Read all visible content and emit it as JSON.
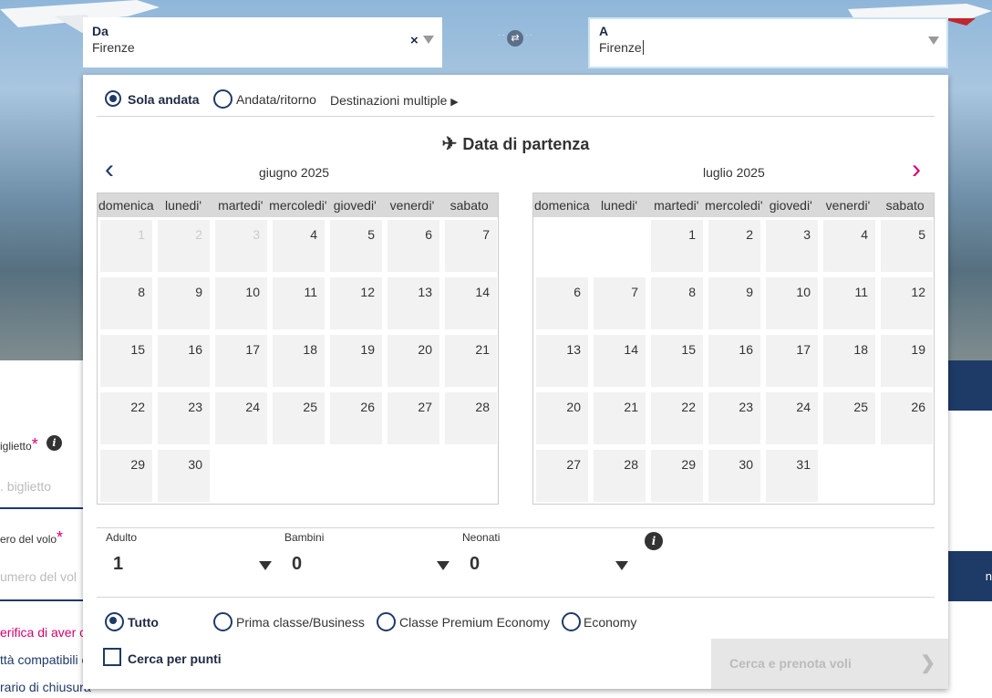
{
  "background": {
    "left_texts": [
      "iglietto",
      "biglietto",
      "ero del volo",
      "umero del vol",
      "erifica di aver co",
      "ttà compatibili c",
      "rario di chiusura"
    ],
    "right_text": "n"
  },
  "from": {
    "label": "Da",
    "value": "Firenze"
  },
  "to": {
    "label": "A",
    "value": "Firenze"
  },
  "trip_type": {
    "options": [
      "Sola andata",
      "Andata/ritorno",
      "Destinazioni multiple"
    ],
    "selected": "Sola andata"
  },
  "calendar": {
    "title": "Data di partenza",
    "weekdays": [
      "domenica",
      "lunedi'",
      "martedi'",
      "mercoledi'",
      "giovedi'",
      "venerdi'",
      "sabato"
    ],
    "months": [
      {
        "name": "giugno 2025",
        "offset": 0,
        "days": 30,
        "disabled_until": 3
      },
      {
        "name": "luglio 2025",
        "offset": 2,
        "days": 31,
        "disabled_until": 0
      }
    ]
  },
  "passengers": {
    "adult": {
      "label": "Adulto",
      "value": "1"
    },
    "children": {
      "label": "Bambini",
      "value": "0"
    },
    "infants": {
      "label": "Neonati",
      "value": "0"
    }
  },
  "cabin": {
    "options": [
      "Tutto",
      "Prima classe/Business",
      "Classe Premium Economy",
      "Economy"
    ],
    "selected": "Tutto"
  },
  "points_label": "Cerca per punti",
  "search_button": "Cerca e prenota voli",
  "colors": {
    "navy": "#1f3a66",
    "accent_pink": "#d6006e",
    "disabled_btn": "#e6e6e6"
  }
}
